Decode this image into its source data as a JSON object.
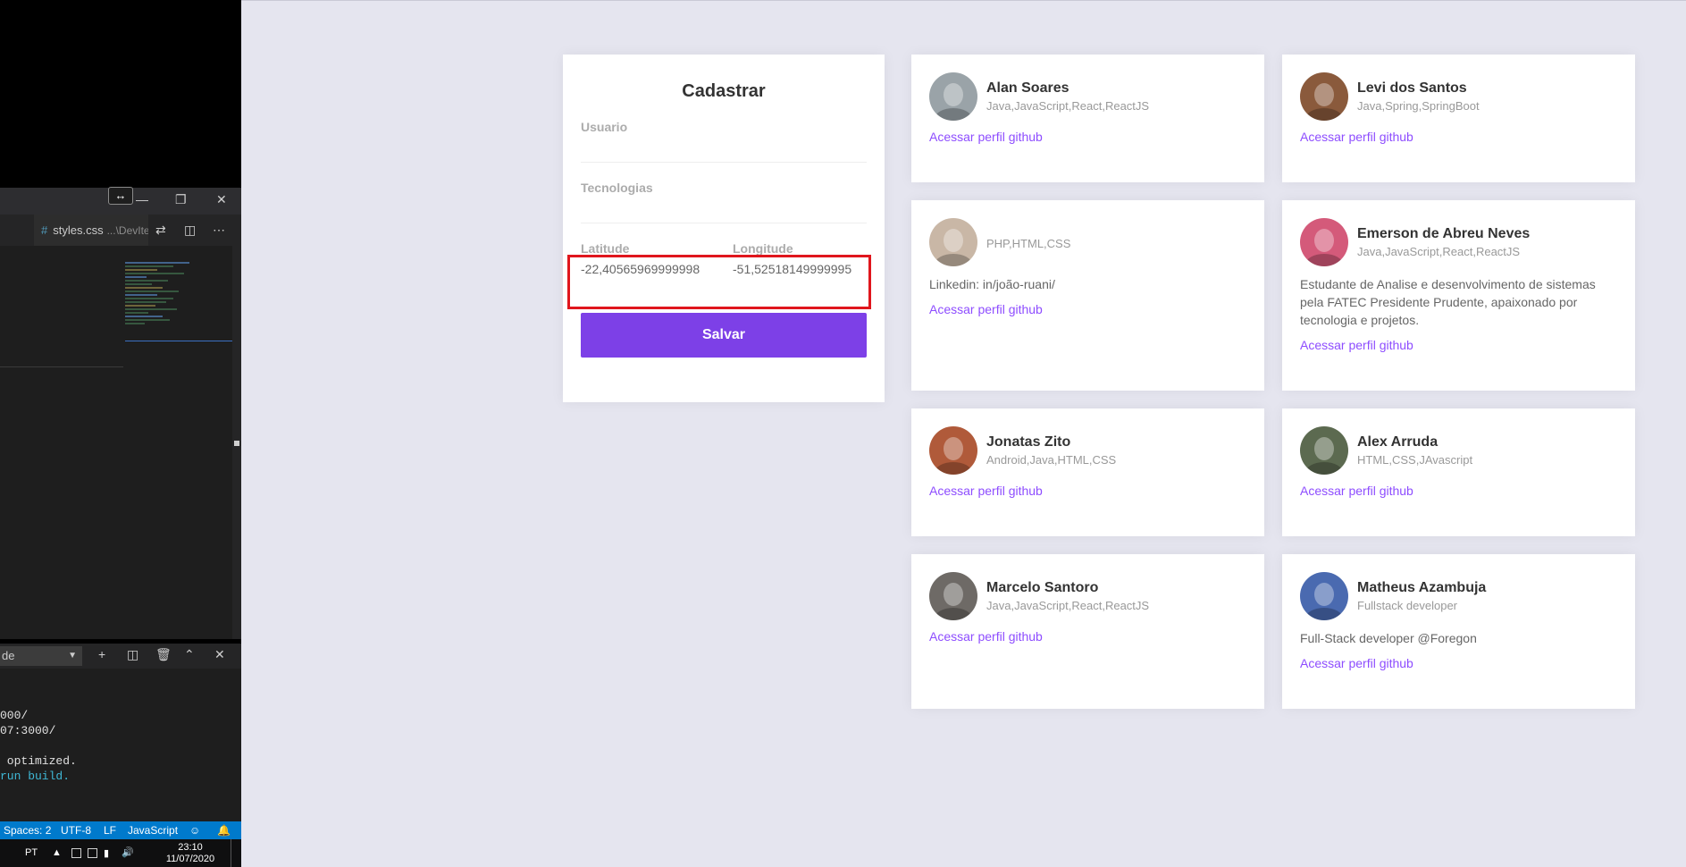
{
  "editor": {
    "tab": {
      "name": "styles.css",
      "path": "...\\DevIte"
    },
    "terminal": {
      "selector": "de",
      "lines": [
        "000/",
        "07:3000/",
        "",
        " optimized.",
        "run build."
      ]
    },
    "statusbar": {
      "spaces": "Spaces: 2",
      "encoding": "UTF-8",
      "eol": "LF",
      "language": "JavaScript"
    },
    "taskbar": {
      "lang": "PT",
      "time": "23:10",
      "date": "11/07/2020"
    }
  },
  "form": {
    "title": "Cadastrar",
    "fields": {
      "usuario": {
        "label": "Usuario",
        "value": ""
      },
      "tecnologias": {
        "label": "Tecnologias",
        "value": ""
      },
      "latitude": {
        "label": "Latitude",
        "value": "-22,40565969999998"
      },
      "longitude": {
        "label": "Longitude",
        "value": "-51,52518149999995"
      }
    },
    "save_label": "Salvar"
  },
  "devs": [
    {
      "name": "Alan Soares",
      "techs": "Java,JavaScript,React,ReactJS",
      "bio": "",
      "link": "Acessar perfil github",
      "avatar_color": "#9aa3a8"
    },
    {
      "name": "Levi dos Santos",
      "techs": "Java,Spring,SpringBoot",
      "bio": "",
      "link": "Acessar perfil github",
      "avatar_color": "#8a5a3c"
    },
    {
      "name": "",
      "techs": "PHP,HTML,CSS",
      "bio": "Linkedin: in/joão-ruani/",
      "link": "Acessar perfil github",
      "avatar_color": "#c9b7a6"
    },
    {
      "name": "Emerson de Abreu Neves",
      "techs": "Java,JavaScript,React,ReactJS",
      "bio": "Estudante de Analise e desenvolvimento de sistemas pela FATEC Presidente Prudente, apaixonado por tecnologia e projetos.",
      "link": "Acessar perfil github",
      "avatar_color": "#d45a7a"
    },
    {
      "name": "Jonatas Zito",
      "techs": "Android,Java,HTML,CSS",
      "bio": "",
      "link": "Acessar perfil github",
      "avatar_color": "#b05a3a"
    },
    {
      "name": "Alex Arruda",
      "techs": "HTML,CSS,JAvascript",
      "bio": "",
      "link": "Acessar perfil github",
      "avatar_color": "#5c6a50"
    },
    {
      "name": "Marcelo Santoro",
      "techs": "Java,JavaScript,React,ReactJS",
      "bio": "",
      "link": "Acessar perfil github",
      "avatar_color": "#6e6a66"
    },
    {
      "name": "Matheus Azambuja",
      "techs": "Fullstack developer",
      "bio": "Full-Stack developer @Foregon",
      "link": "Acessar perfil github",
      "avatar_color": "#4a6ab0"
    }
  ]
}
